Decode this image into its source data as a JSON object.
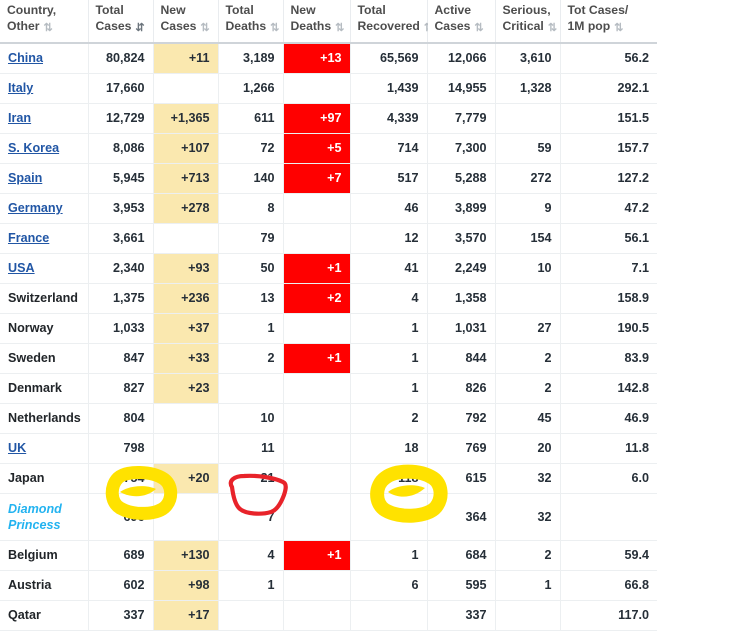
{
  "table": {
    "columns": [
      {
        "label_line1": "Country,",
        "label_line2": "Other",
        "sort": "both",
        "active": false
      },
      {
        "label_line1": "Total",
        "label_line2": "Cases",
        "sort": "desc",
        "active": true
      },
      {
        "label_line1": "New",
        "label_line2": "Cases",
        "sort": "both",
        "active": false
      },
      {
        "label_line1": "Total",
        "label_line2": "Deaths",
        "sort": "both",
        "active": false
      },
      {
        "label_line1": "New",
        "label_line2": "Deaths",
        "sort": "both",
        "active": false
      },
      {
        "label_line1": "Total",
        "label_line2": "Recovered",
        "sort": "both",
        "active": false
      },
      {
        "label_line1": "Active",
        "label_line2": "Cases",
        "sort": "both",
        "active": false
      },
      {
        "label_line1": "Serious,",
        "label_line2": "Critical",
        "sort": "both",
        "active": false
      },
      {
        "label_line1": "Tot Cases/",
        "label_line2": "1M pop",
        "sort": "both",
        "active": false
      }
    ],
    "rows": [
      {
        "country": "China",
        "link": true,
        "ship": false,
        "total_cases": "80,824",
        "new_cases": "+11",
        "total_deaths": "3,189",
        "new_deaths": "+13",
        "total_recovered": "65,569",
        "active_cases": "12,066",
        "serious_critical": "3,610",
        "cases_per_1m": "56.2"
      },
      {
        "country": "Italy",
        "link": true,
        "ship": false,
        "total_cases": "17,660",
        "new_cases": "",
        "total_deaths": "1,266",
        "new_deaths": "",
        "total_recovered": "1,439",
        "active_cases": "14,955",
        "serious_critical": "1,328",
        "cases_per_1m": "292.1"
      },
      {
        "country": "Iran",
        "link": true,
        "ship": false,
        "total_cases": "12,729",
        "new_cases": "+1,365",
        "total_deaths": "611",
        "new_deaths": "+97",
        "total_recovered": "4,339",
        "active_cases": "7,779",
        "serious_critical": "",
        "cases_per_1m": "151.5"
      },
      {
        "country": "S. Korea",
        "link": true,
        "ship": false,
        "total_cases": "8,086",
        "new_cases": "+107",
        "total_deaths": "72",
        "new_deaths": "+5",
        "total_recovered": "714",
        "active_cases": "7,300",
        "serious_critical": "59",
        "cases_per_1m": "157.7"
      },
      {
        "country": "Spain",
        "link": true,
        "ship": false,
        "total_cases": "5,945",
        "new_cases": "+713",
        "total_deaths": "140",
        "new_deaths": "+7",
        "total_recovered": "517",
        "active_cases": "5,288",
        "serious_critical": "272",
        "cases_per_1m": "127.2"
      },
      {
        "country": "Germany",
        "link": true,
        "ship": false,
        "total_cases": "3,953",
        "new_cases": "+278",
        "total_deaths": "8",
        "new_deaths": "",
        "total_recovered": "46",
        "active_cases": "3,899",
        "serious_critical": "9",
        "cases_per_1m": "47.2"
      },
      {
        "country": "France",
        "link": true,
        "ship": false,
        "total_cases": "3,661",
        "new_cases": "",
        "total_deaths": "79",
        "new_deaths": "",
        "total_recovered": "12",
        "active_cases": "3,570",
        "serious_critical": "154",
        "cases_per_1m": "56.1"
      },
      {
        "country": "USA",
        "link": true,
        "ship": false,
        "total_cases": "2,340",
        "new_cases": "+93",
        "total_deaths": "50",
        "new_deaths": "+1",
        "total_recovered": "41",
        "active_cases": "2,249",
        "serious_critical": "10",
        "cases_per_1m": "7.1"
      },
      {
        "country": "Switzerland",
        "link": false,
        "ship": false,
        "total_cases": "1,375",
        "new_cases": "+236",
        "total_deaths": "13",
        "new_deaths": "+2",
        "total_recovered": "4",
        "active_cases": "1,358",
        "serious_critical": "",
        "cases_per_1m": "158.9"
      },
      {
        "country": "Norway",
        "link": false,
        "ship": false,
        "total_cases": "1,033",
        "new_cases": "+37",
        "total_deaths": "1",
        "new_deaths": "",
        "total_recovered": "1",
        "active_cases": "1,031",
        "serious_critical": "27",
        "cases_per_1m": "190.5"
      },
      {
        "country": "Sweden",
        "link": false,
        "ship": false,
        "total_cases": "847",
        "new_cases": "+33",
        "total_deaths": "2",
        "new_deaths": "+1",
        "total_recovered": "1",
        "active_cases": "844",
        "serious_critical": "2",
        "cases_per_1m": "83.9"
      },
      {
        "country": "Denmark",
        "link": false,
        "ship": false,
        "total_cases": "827",
        "new_cases": "+23",
        "total_deaths": "",
        "new_deaths": "",
        "total_recovered": "1",
        "active_cases": "826",
        "serious_critical": "2",
        "cases_per_1m": "142.8"
      },
      {
        "country": "Netherlands",
        "link": false,
        "ship": false,
        "total_cases": "804",
        "new_cases": "",
        "total_deaths": "10",
        "new_deaths": "",
        "total_recovered": "2",
        "active_cases": "792",
        "serious_critical": "45",
        "cases_per_1m": "46.9"
      },
      {
        "country": "UK",
        "link": true,
        "ship": false,
        "total_cases": "798",
        "new_cases": "",
        "total_deaths": "11",
        "new_deaths": "",
        "total_recovered": "18",
        "active_cases": "769",
        "serious_critical": "20",
        "cases_per_1m": "11.8"
      },
      {
        "country": "Japan",
        "link": false,
        "ship": false,
        "total_cases": "754",
        "new_cases": "+20",
        "total_deaths": "21",
        "new_deaths": "",
        "total_recovered": "118",
        "active_cases": "615",
        "serious_critical": "32",
        "cases_per_1m": "6.0"
      },
      {
        "country": "Diamond Princess",
        "link": false,
        "ship": true,
        "total_cases": "696",
        "new_cases": "",
        "total_deaths": "7",
        "new_deaths": "",
        "total_recovered": "325",
        "active_cases": "364",
        "serious_critical": "32",
        "cases_per_1m": ""
      },
      {
        "country": "Belgium",
        "link": false,
        "ship": false,
        "total_cases": "689",
        "new_cases": "+130",
        "total_deaths": "4",
        "new_deaths": "+1",
        "total_recovered": "1",
        "active_cases": "684",
        "serious_critical": "2",
        "cases_per_1m": "59.4"
      },
      {
        "country": "Austria",
        "link": false,
        "ship": false,
        "total_cases": "602",
        "new_cases": "+98",
        "total_deaths": "1",
        "new_deaths": "",
        "total_recovered": "6",
        "active_cases": "595",
        "serious_critical": "1",
        "cases_per_1m": "66.8"
      },
      {
        "country": "Qatar",
        "link": false,
        "ship": false,
        "total_cases": "337",
        "new_cases": "+17",
        "total_deaths": "",
        "new_deaths": "",
        "total_recovered": "",
        "active_cases": "337",
        "serious_critical": "",
        "cases_per_1m": "117.0"
      }
    ]
  },
  "annotations": {
    "highlight_color": "#FFE200",
    "circle_color": "#E8232A",
    "items": [
      {
        "name": "highlight-total-cases-diamond-princess",
        "shape": "yellow-ring",
        "target_value": "696"
      },
      {
        "name": "circle-total-deaths-diamond-princess",
        "shape": "red-outline",
        "target_value": "7"
      },
      {
        "name": "highlight-total-recovered-diamond-princess",
        "shape": "yellow-ring",
        "target_value": "325"
      }
    ]
  },
  "colors": {
    "new_cases_bg": "#fae8af",
    "new_deaths_bg": "#ff0000",
    "link": "#2156a5",
    "ship_text": "#23b3f0"
  }
}
